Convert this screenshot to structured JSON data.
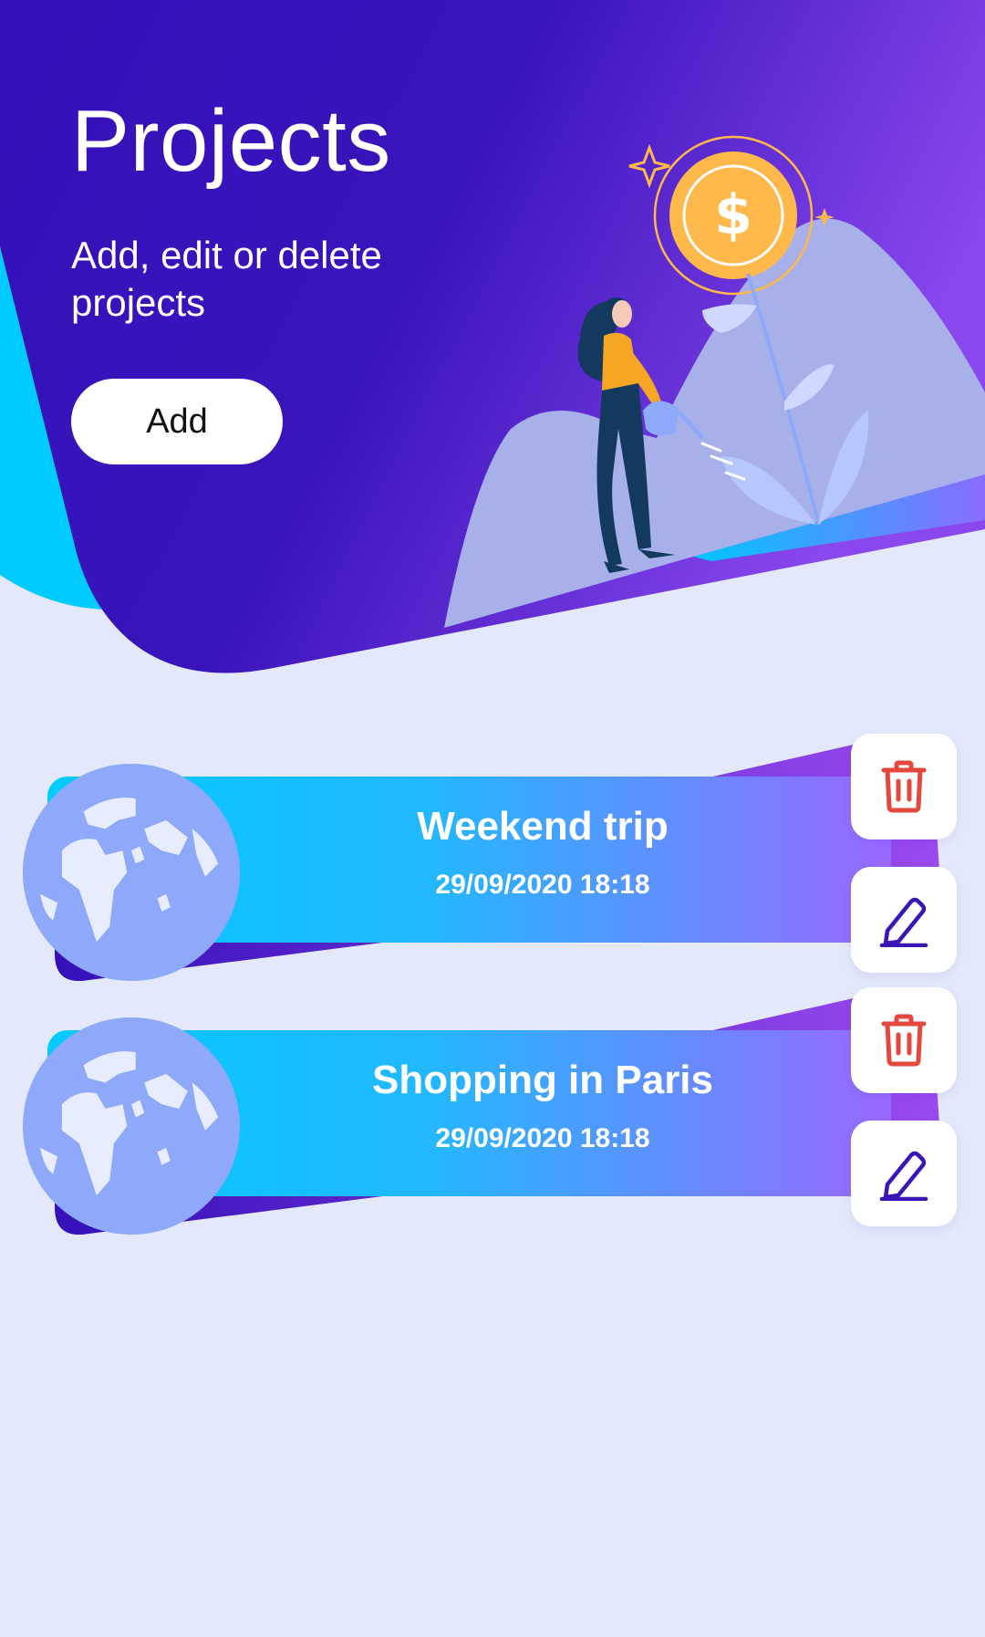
{
  "header": {
    "title": "Projects",
    "subtitle": "Add, edit or delete projects",
    "add_label": "Add"
  },
  "projects": [
    {
      "name": "Weekend trip",
      "date": "29/09/2020 18:18"
    },
    {
      "name": "Shopping in Paris",
      "date": "29/09/2020 18:18"
    }
  ],
  "icons": {
    "delete": "trash-icon",
    "edit": "pencil-icon",
    "project": "globe-icon",
    "illustration": "woman-watering-money-plant"
  },
  "colors": {
    "background": "#e3e8fa",
    "hero_primary": "#3510b8",
    "hero_secondary": "#8a47ee",
    "accent_cyan": "#00cbff",
    "delete": "#e5473c",
    "edit": "#3a16b8",
    "coin": "#ffb84a",
    "globe": "#8ea9fa"
  }
}
